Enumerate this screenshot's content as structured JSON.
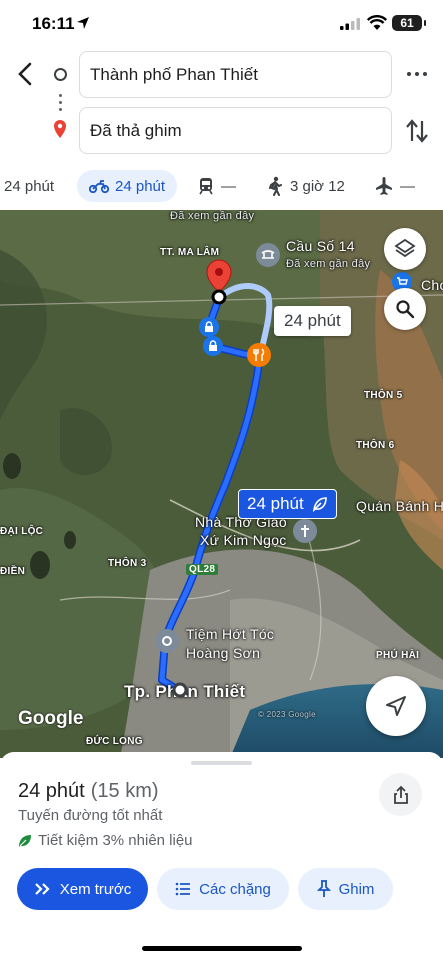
{
  "status": {
    "time": "16:11",
    "battery": "61"
  },
  "route": {
    "origin": "Thành phố Phan Thiết",
    "destination": "Đã thả ghim"
  },
  "modes": [
    {
      "name": "car",
      "label": "24 phút"
    },
    {
      "name": "motorbike",
      "label": "24 phút",
      "active": true
    },
    {
      "name": "transit",
      "label": "—"
    },
    {
      "name": "walk",
      "label": "3 giờ 12"
    },
    {
      "name": "flight",
      "label": "—"
    }
  ],
  "map": {
    "labels": {
      "viewed_top": "Đã xem gần đây",
      "ma_lam": "TT. MA LÂM",
      "cau_so_14": "Cầu Số 14",
      "cau_so_14_sub": "Đã xem gần đây",
      "cho": "Chợ",
      "thon5": "THÔN 5",
      "thon6": "THÔN 6",
      "quan_banh": "Quán Bánh H",
      "nha_tho_1": "Nhà Thờ Giáo",
      "nha_tho_2": "Xứ Kim Ngọc",
      "dai_loc": "ĐẠI LỘC",
      "dien": "ĐIỀN",
      "thon3": "THÔN 3",
      "ql28": "QL28",
      "tiem_1": "Tiệm Hớt Tóc",
      "tiem_2": "Hoàng Sơn",
      "tp_phan_thiet": "Tp. Phan Thiết",
      "phu_hai": "PHÚ HÀI",
      "duc_long": "ĐỨC LONG",
      "copyright": "© 2023 Google",
      "google": "Google"
    },
    "alt_route_time": "24 phút",
    "main_route_time": "24 phút"
  },
  "sheet": {
    "duration": "24 phút",
    "distance": "(15 km)",
    "best_route": "Tuyến đường tốt nhất",
    "fuel_saving": "Tiết kiệm 3% nhiên liệu",
    "actions": {
      "preview": "Xem trước",
      "steps": "Các chặng",
      "pin": "Ghim"
    }
  },
  "colors": {
    "route_blue": "#1a56e0",
    "chip_bg": "#e8f0fe",
    "pin_red": "#ea4335",
    "poi_orange": "#f57c00"
  }
}
